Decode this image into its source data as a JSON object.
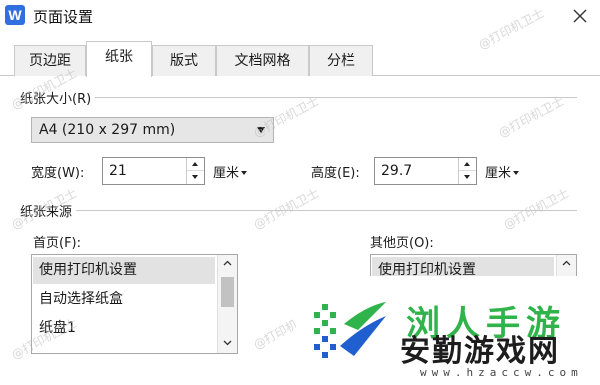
{
  "window": {
    "title": "页面设置",
    "app_icon_letter": "W"
  },
  "tabs": [
    {
      "label": "页边距",
      "active": false
    },
    {
      "label": "纸张",
      "active": true
    },
    {
      "label": "版式",
      "active": false
    },
    {
      "label": "文档网格",
      "active": false
    },
    {
      "label": "分栏",
      "active": false
    }
  ],
  "paper_size": {
    "section_label": "纸张大小(R)",
    "selected": "A4 (210 x 297 mm)",
    "width_label": "宽度(W):",
    "width_value": "21",
    "width_unit": "厘米",
    "height_label": "高度(E):",
    "height_value": "29.7",
    "height_unit": "厘米"
  },
  "paper_source": {
    "section_label": "纸张来源",
    "first_page_label": "首页(F):",
    "first_page_items": [
      "使用打印机设置",
      "自动选择纸盒",
      "纸盘1"
    ],
    "first_page_selected_index": 0,
    "other_pages_label": "其他页(O):",
    "other_pages_items": [
      "使用打印机设置"
    ],
    "other_pages_selected_index": 0
  },
  "watermark_text": "@打印机卫士",
  "overlay_logo": {
    "top_text": "浏人手游",
    "main_text": "安勤游戏网",
    "url": "www.hzaccw.com"
  },
  "colors": {
    "accent_blue": "#2f6fe0",
    "logo_green": "#2fb34a",
    "logo_blue": "#1f5fd0"
  }
}
